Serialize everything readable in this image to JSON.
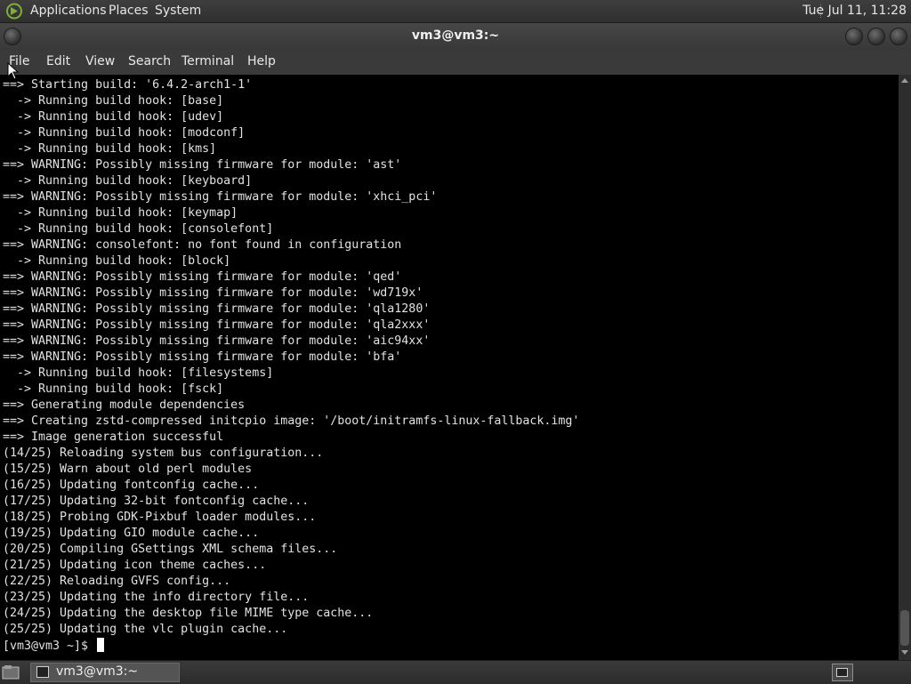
{
  "top_panel": {
    "menus": [
      "Applications",
      "Places",
      "System"
    ],
    "clock": "Tue Jul 11, 11:28"
  },
  "window": {
    "title": "vm3@vm3:~"
  },
  "menubar": [
    "File",
    "Edit",
    "View",
    "Search",
    "Terminal",
    "Help"
  ],
  "terminal": {
    "lines": [
      "==> Starting build: '6.4.2-arch1-1'",
      "  -> Running build hook: [base]",
      "  -> Running build hook: [udev]",
      "  -> Running build hook: [modconf]",
      "  -> Running build hook: [kms]",
      "==> WARNING: Possibly missing firmware for module: 'ast'",
      "  -> Running build hook: [keyboard]",
      "==> WARNING: Possibly missing firmware for module: 'xhci_pci'",
      "  -> Running build hook: [keymap]",
      "  -> Running build hook: [consolefont]",
      "==> WARNING: consolefont: no font found in configuration",
      "  -> Running build hook: [block]",
      "==> WARNING: Possibly missing firmware for module: 'qed'",
      "==> WARNING: Possibly missing firmware for module: 'wd719x'",
      "==> WARNING: Possibly missing firmware for module: 'qla1280'",
      "==> WARNING: Possibly missing firmware for module: 'qla2xxx'",
      "==> WARNING: Possibly missing firmware for module: 'aic94xx'",
      "==> WARNING: Possibly missing firmware for module: 'bfa'",
      "  -> Running build hook: [filesystems]",
      "  -> Running build hook: [fsck]",
      "==> Generating module dependencies",
      "==> Creating zstd-compressed initcpio image: '/boot/initramfs-linux-fallback.img'",
      "==> Image generation successful",
      "(14/25) Reloading system bus configuration...",
      "(15/25) Warn about old perl modules",
      "(16/25) Updating fontconfig cache...",
      "(17/25) Updating 32-bit fontconfig cache...",
      "(18/25) Probing GDK-Pixbuf loader modules...",
      "(19/25) Updating GIO module cache...",
      "(20/25) Compiling GSettings XML schema files...",
      "(21/25) Updating icon theme caches...",
      "(22/25) Reloading GVFS config...",
      "(23/25) Updating the info directory file...",
      "(24/25) Updating the desktop file MIME type cache...",
      "(25/25) Updating the vlc plugin cache..."
    ],
    "prompt": "[vm3@vm3 ~]$ "
  },
  "taskbar": {
    "task_label": "vm3@vm3:~"
  },
  "icons": {
    "distro": "distro-logo-icon",
    "show_desktop": "show-desktop-icon",
    "task": "terminal-icon",
    "workspace": "workspace-switcher-icon"
  },
  "colors": {
    "terminal_bg": "#000000",
    "terminal_fg": "#e2e2e2",
    "panel_bg": "#353535",
    "logo_green": "#7fae3a"
  }
}
